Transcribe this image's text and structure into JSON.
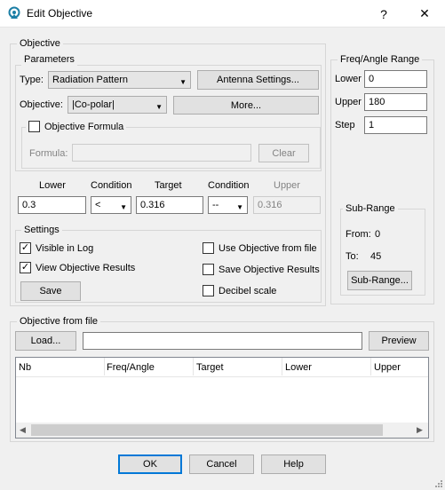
{
  "window": {
    "title": "Edit Objective",
    "help_glyph": "?",
    "close_glyph": "✕"
  },
  "objective_group": {
    "legend": "Objective",
    "parameters": {
      "legend": "Parameters",
      "type_label": "Type:",
      "type_value": "Radiation Pattern",
      "antenna_settings_button": "Antenna Settings...",
      "objective_label": "Objective:",
      "objective_value": "|Co-polar|",
      "more_button": "More...",
      "formula_checkbox_label": "Objective Formula",
      "formula_label": "Formula:",
      "clear_button": "Clear"
    },
    "limits": {
      "lower_label": "Lower",
      "condition_label": "Condition",
      "target_label": "Target",
      "condition2_label": "Condition",
      "upper_label": "Upper",
      "lower_value": "0.3",
      "condition_value": "<",
      "target_value": "0.316",
      "condition2_value": "--",
      "upper_value": "0.316"
    },
    "settings": {
      "legend": "Settings",
      "visible_in_log": "Visible in Log",
      "view_objective_results": "View Objective Results",
      "save_button": "Save",
      "use_objective_from_file": "Use Objective from file",
      "save_objective_results": "Save Objective Results",
      "decibel_scale": "Decibel scale",
      "check_mark": "✓"
    }
  },
  "freq_angle_range": {
    "legend": "Freq/Angle Range",
    "lower_label": "Lower",
    "lower_value": "0",
    "upper_label": "Upper",
    "upper_value": "180",
    "step_label": "Step",
    "step_value": "1",
    "subrange": {
      "legend": "Sub-Range",
      "from_label": "From:",
      "from_value": "0",
      "to_label": "To:",
      "to_value": "45",
      "button": "Sub-Range..."
    }
  },
  "objective_from_file": {
    "legend": "Objective from file",
    "load_button": "Load...",
    "file_path": "",
    "preview_button": "Preview",
    "columns": [
      "Nb",
      "Freq/Angle",
      "Target",
      "Lower",
      "Upper"
    ]
  },
  "footer": {
    "ok": "OK",
    "cancel": "Cancel",
    "help": "Help"
  }
}
